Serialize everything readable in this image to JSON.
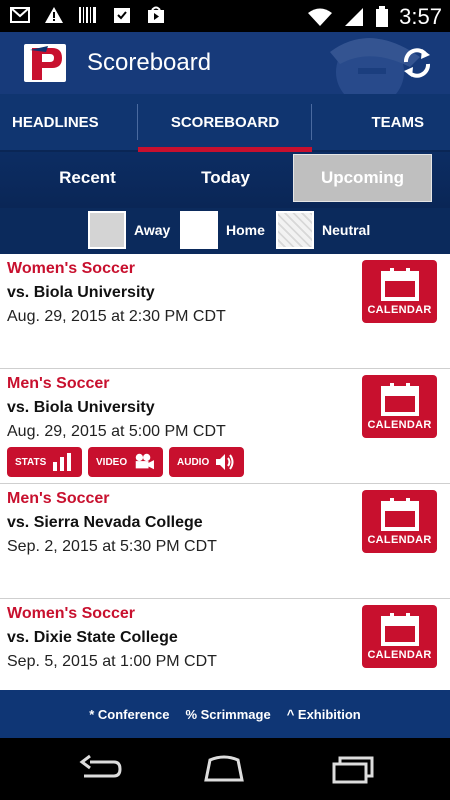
{
  "status_bar": {
    "time": "3:57"
  },
  "action_bar": {
    "title": "Scoreboard"
  },
  "nav_tabs": [
    {
      "label": "HEADLINES"
    },
    {
      "label": "SCOREBOARD"
    },
    {
      "label": "TEAMS"
    }
  ],
  "segments": [
    {
      "label": "Recent"
    },
    {
      "label": "Today"
    },
    {
      "label": "Upcoming"
    }
  ],
  "legend": {
    "away": "Away",
    "home": "Home",
    "neutral": "Neutral"
  },
  "events": [
    {
      "sport": "Women's Soccer",
      "opponent": "vs. Biola University",
      "datetime": "Aug. 29, 2015 at 2:30 PM CDT",
      "calendar_label": "CALENDAR"
    },
    {
      "sport": "Men's Soccer",
      "opponent": "vs. Biola University",
      "datetime": "Aug. 29, 2015 at 5:00 PM CDT",
      "calendar_label": "CALENDAR",
      "media": {
        "stats": "STATS",
        "video": "VIDEO",
        "audio": "AUDIO"
      }
    },
    {
      "sport": "Men's Soccer",
      "opponent": "vs. Sierra Nevada College",
      "datetime": "Sep. 2, 2015 at 5:30 PM CDT",
      "calendar_label": "CALENDAR"
    },
    {
      "sport": "Women's Soccer",
      "opponent": "vs. Dixie State College",
      "datetime": "Sep. 5, 2015 at 1:00 PM CDT",
      "calendar_label": "CALENDAR"
    }
  ],
  "footnote": {
    "conference": "* Conference",
    "scrimmage": "% Scrimmage",
    "exhibition": "^ Exhibition"
  },
  "colors": {
    "brand_red": "#c8102e",
    "brand_navy": "#103570",
    "selected_segment": "#bfbfbf"
  }
}
